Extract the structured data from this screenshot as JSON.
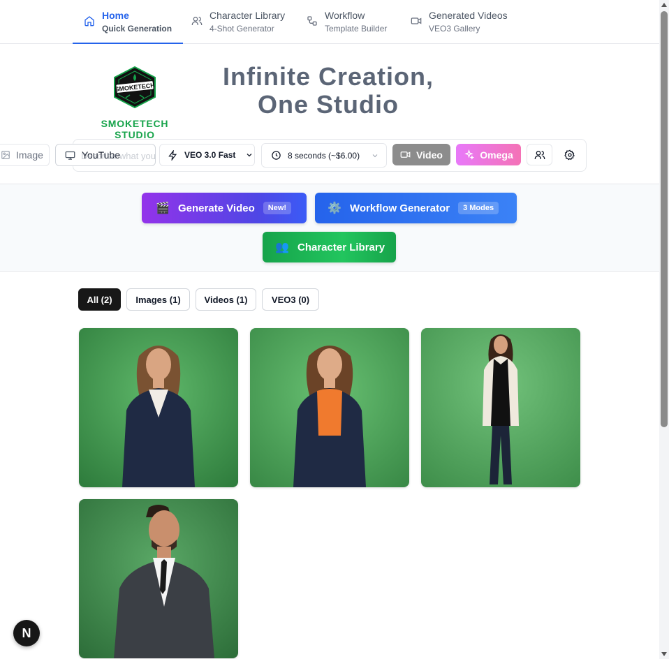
{
  "nav": {
    "tabs": [
      {
        "title": "Home",
        "subtitle": "Quick Generation",
        "icon": "home-icon",
        "active": true
      },
      {
        "title": "Character Library",
        "subtitle": "4-Shot Generator",
        "icon": "users-icon",
        "active": false
      },
      {
        "title": "Workflow",
        "subtitle": "Template Builder",
        "icon": "workflow-icon",
        "active": false
      },
      {
        "title": "Generated Videos",
        "subtitle": "VEO3 Gallery",
        "icon": "video-camera-icon",
        "active": false
      }
    ]
  },
  "hero": {
    "logo_badge_text": "SMOKETECH",
    "brand_name": "SMOKETECH STUDIO",
    "title_line1": "Infinite Creation,",
    "title_line2": "One Studio"
  },
  "prompt_bar": {
    "image_mode_label": "Image",
    "youtube_mode_label": "YouTube",
    "prompt_placeholder": "Describe what you",
    "model_select": "VEO 3.0 Fast",
    "duration_select": "8 seconds (~$6.00)",
    "video_button": "Video",
    "omega_button": "Omega"
  },
  "actions": {
    "generate_video": {
      "label": "Generate Video",
      "badge": "New!",
      "emoji": "🎬"
    },
    "workflow_generator": {
      "label": "Workflow Generator",
      "badge": "3 Modes",
      "emoji": "⚙️"
    },
    "character_library": {
      "label": "Character Library",
      "emoji": "👥"
    }
  },
  "filters": [
    {
      "label": "All (2)",
      "active": true
    },
    {
      "label": "Images (1)",
      "active": false
    },
    {
      "label": "Videos (1)",
      "active": false
    },
    {
      "label": "VEO3 (0)",
      "active": false
    }
  ],
  "gallery": [
    {
      "subject": "woman in navy blazer, white blouse, green background"
    },
    {
      "subject": "woman in navy blazer, orange top, green background"
    },
    {
      "subject": "woman in cream blazer, full body, green background"
    },
    {
      "subject": "man in dark suit, white shirt, green background"
    }
  ],
  "floating_badge": "N",
  "colors": {
    "accent": "#2563eb",
    "brand_green": "#16a34a",
    "video_button": "#8c8c8c",
    "omega_gradient": [
      "#e879f9",
      "#f472b6"
    ]
  }
}
